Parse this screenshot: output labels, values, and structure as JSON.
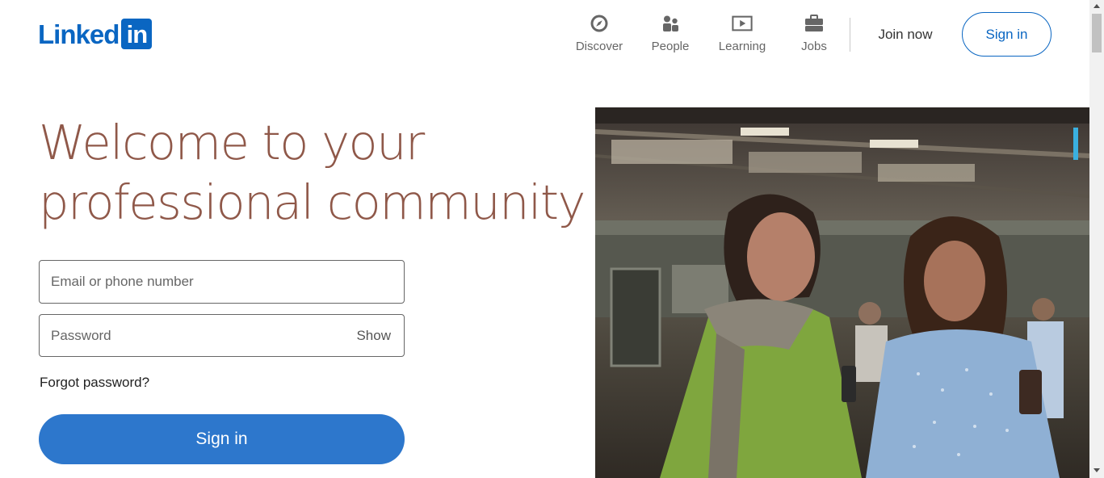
{
  "brand": {
    "logo_word": "Linked",
    "logo_box": "in",
    "color": "#0a66c2"
  },
  "nav": {
    "items": [
      {
        "label": "Discover",
        "icon": "compass-icon"
      },
      {
        "label": "People",
        "icon": "people-icon"
      },
      {
        "label": "Learning",
        "icon": "video-play-icon"
      },
      {
        "label": "Jobs",
        "icon": "briefcase-icon"
      }
    ],
    "join_now": "Join now",
    "sign_in": "Sign in"
  },
  "hero": {
    "title_line_1": "Welcome to your",
    "title_line_2": "professional community",
    "title_color": "#8f5849"
  },
  "form": {
    "email_placeholder": "Email or phone number",
    "email_value": "",
    "password_placeholder": "Password",
    "password_value": "",
    "show_label": "Show",
    "forgot_label": "Forgot password?",
    "submit_label": "Sign in",
    "submit_color": "#2d77cc"
  },
  "photo": {
    "subject": "two women smiling and talking in a train station"
  }
}
